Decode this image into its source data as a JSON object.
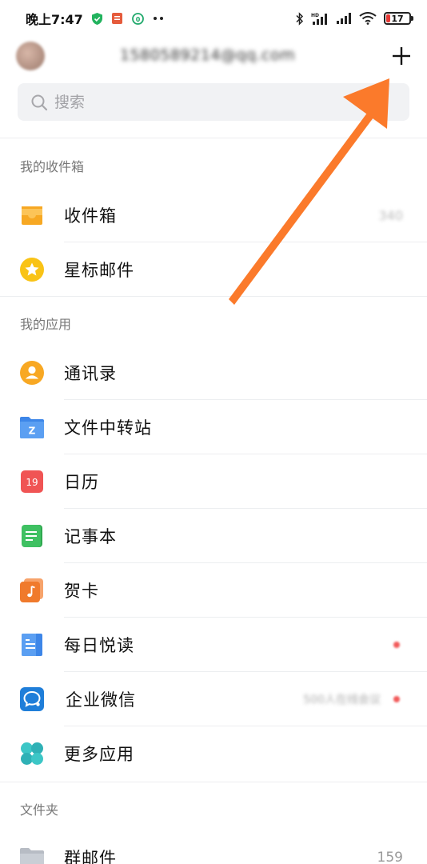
{
  "status_bar": {
    "time": "晚上7:47",
    "battery": "17",
    "battery_percent": 17
  },
  "header": {
    "account": "1580589214@qq.com",
    "add_icon": "plus-icon"
  },
  "search": {
    "placeholder": "搜索"
  },
  "sections": {
    "inbox": "我的收件箱",
    "apps": "我的应用",
    "folders": "文件夹"
  },
  "inbox_items": [
    {
      "label": "收件箱",
      "count": "340",
      "icon": "inbox-tray-icon"
    },
    {
      "label": "星标邮件",
      "icon": "star-icon"
    }
  ],
  "apps": [
    {
      "label": "通讯录",
      "icon": "contacts-icon"
    },
    {
      "label": "文件中转站",
      "icon": "file-transfer-icon",
      "icon_text": "Z"
    },
    {
      "label": "日历",
      "icon": "calendar-icon",
      "icon_text": "19"
    },
    {
      "label": "记事本",
      "icon": "notepad-icon"
    },
    {
      "label": "贺卡",
      "icon": "greeting-card-icon"
    },
    {
      "label": "每日悦读",
      "icon": "daily-read-icon"
    },
    {
      "label": "企业微信",
      "icon": "wecom-icon",
      "note": "500人在线会议"
    },
    {
      "label": "更多应用",
      "icon": "more-apps-icon"
    }
  ],
  "folders": [
    {
      "label": "群邮件",
      "count": "159",
      "icon": "folder-icon"
    }
  ],
  "colors": {
    "accent_orange": "#f5a623",
    "star_yellow": "#f9c316",
    "arrow": "#fb7a2b",
    "unread_dot": "#f25a5a"
  }
}
